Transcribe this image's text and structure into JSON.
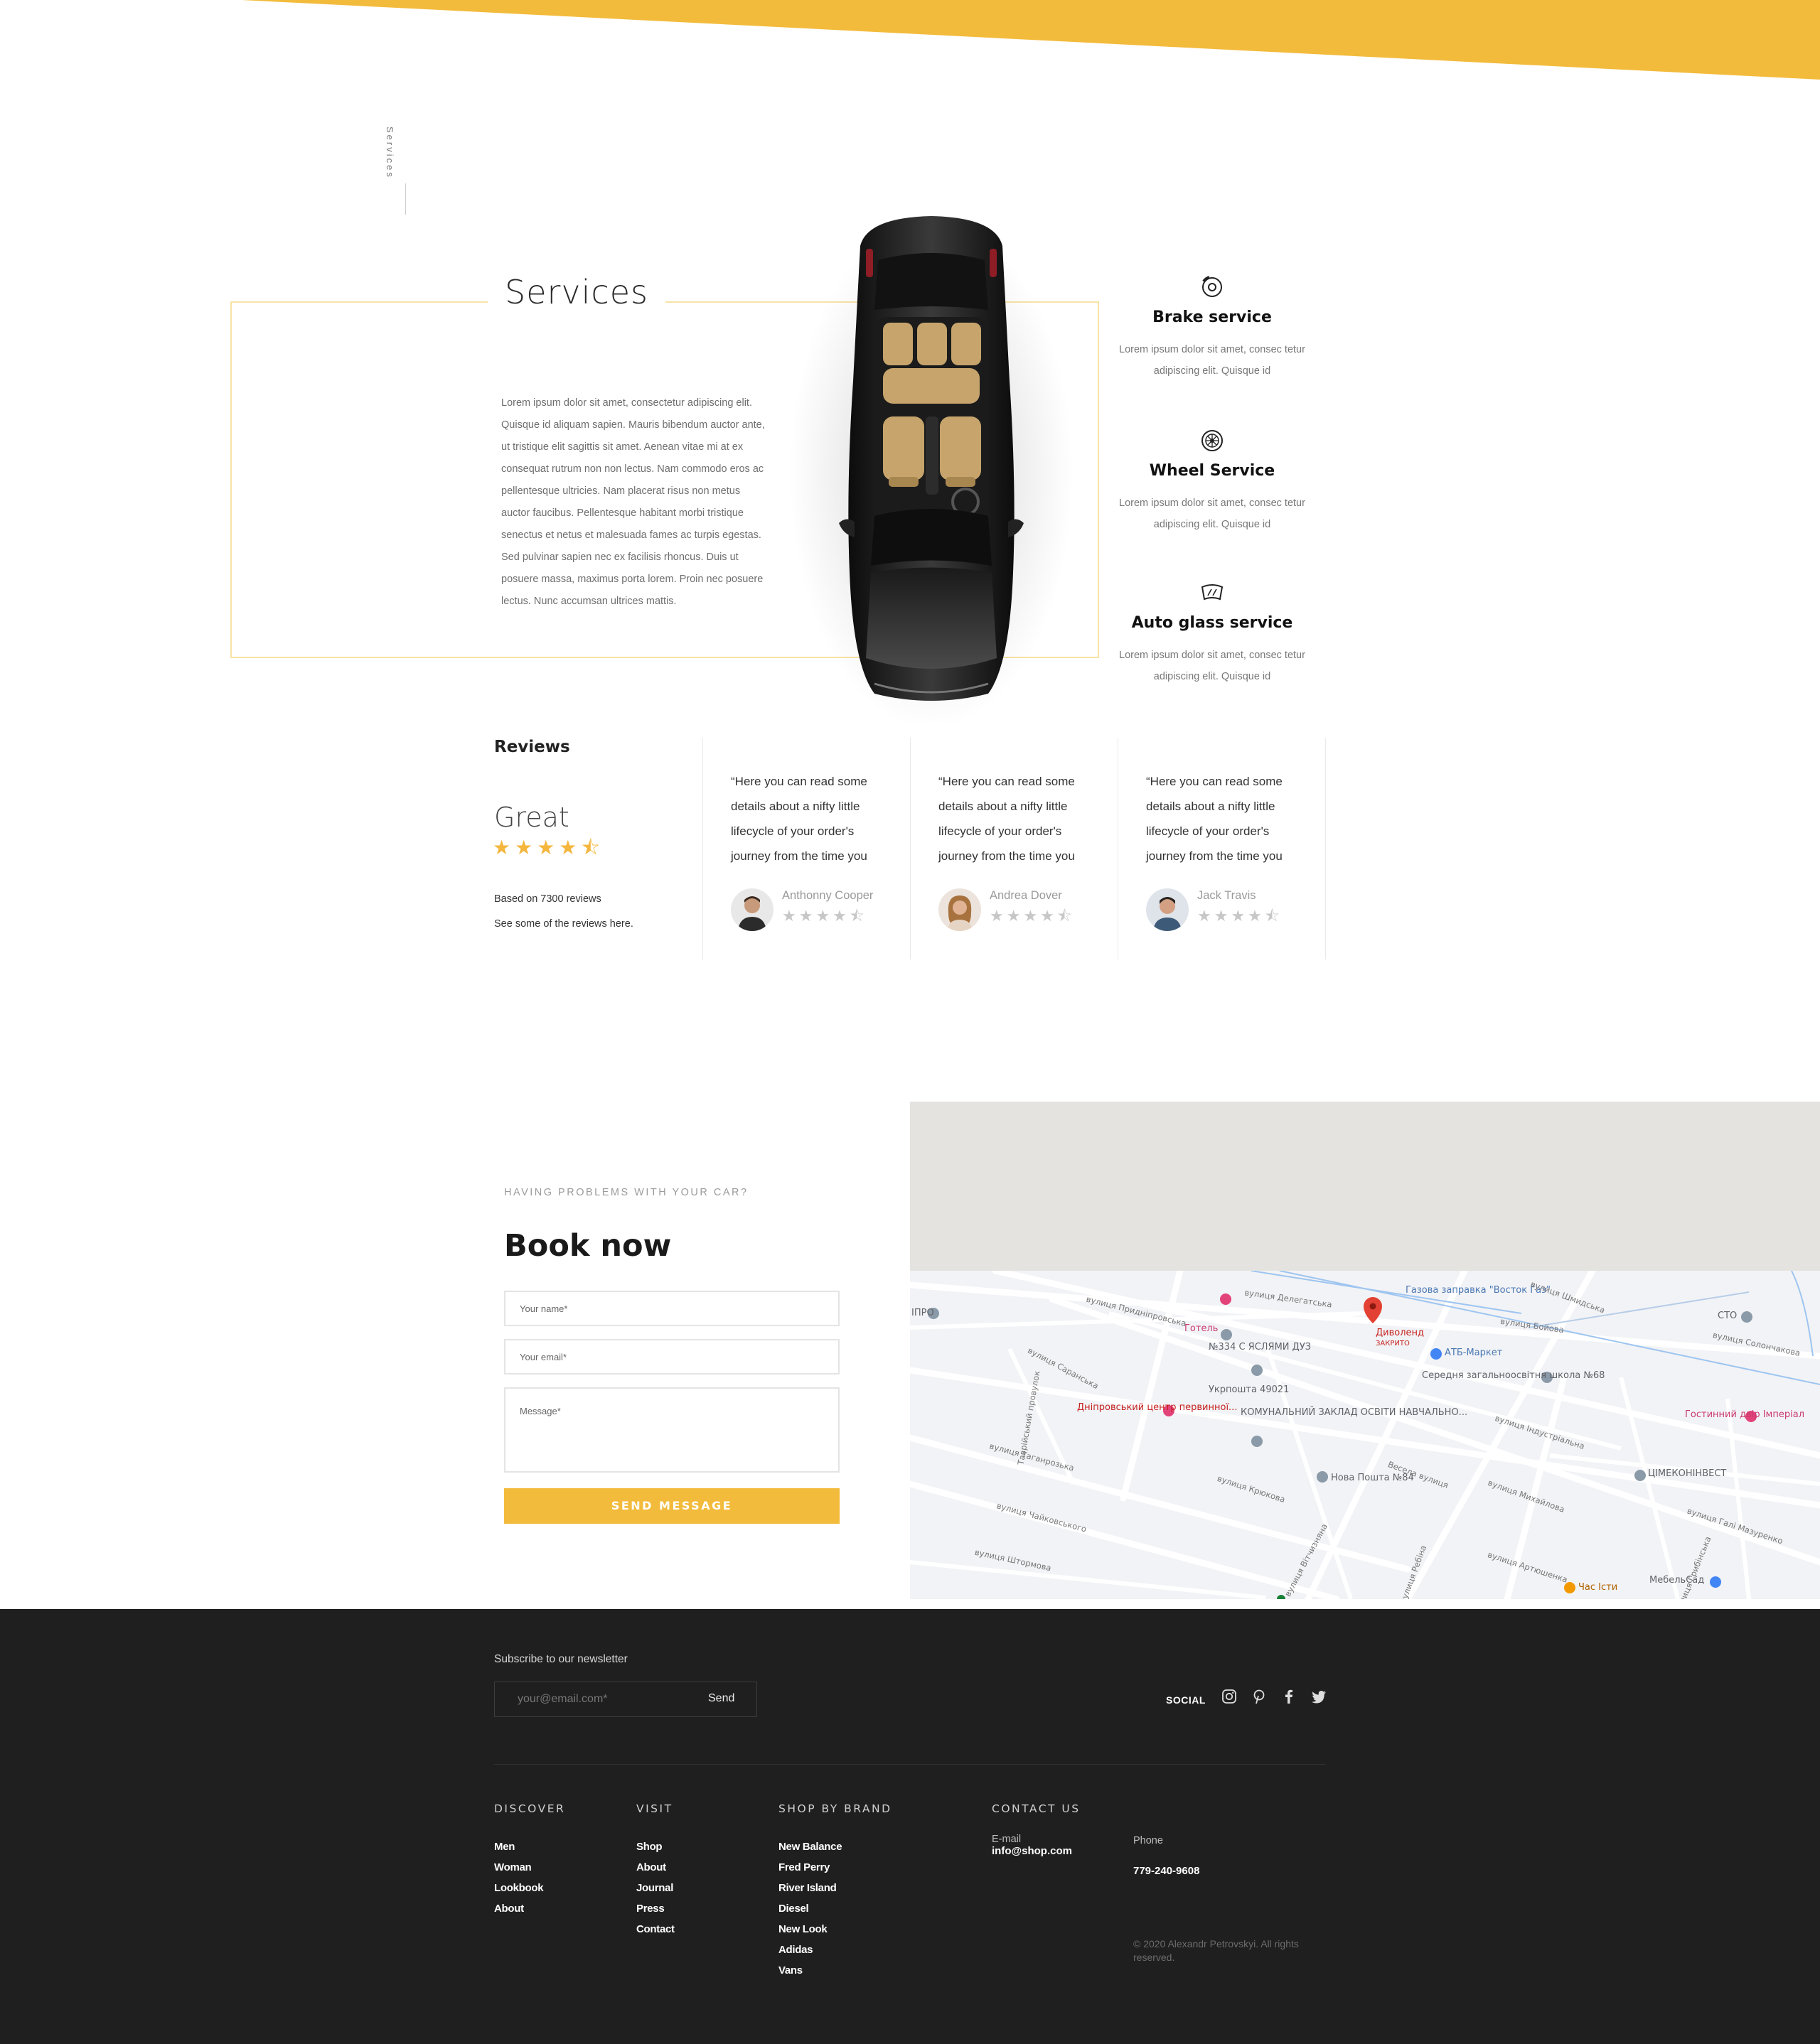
{
  "side_label": "Services",
  "services": {
    "title": "Services",
    "text": "Lorem ipsum dolor sit amet, consectetur adipiscing elit. Quisque id aliquam sapien. Mauris bibendum auctor ante, ut tristique elit sagittis sit amet. Aenean vitae mi at ex consequat rutrum non non lectus. Nam commodo eros ac pellentesque ultricies. Nam placerat risus non metus auctor faucibus. Pellentesque habitant morbi tristique senectus et netus et malesuada fames ac turpis egestas. Sed pulvinar sapien nec ex facilisis rhoncus. Duis ut posuere massa, maximus porta lorem. Proin nec posuere lectus. Nunc accumsan ultrices mattis.",
    "items": [
      {
        "name": "Brake service",
        "desc": "Lorem ipsum dolor sit amet, consec tetur adipiscing elit. Quisque id",
        "icon": "brake-disc-icon"
      },
      {
        "name": "Wheel Service",
        "desc": "Lorem ipsum dolor sit amet, consec tetur adipiscing elit. Quisque id",
        "icon": "wheel-icon"
      },
      {
        "name": "Auto glass service",
        "desc": "Lorem ipsum dolor sit amet, consec tetur adipiscing elit. Quisque id",
        "icon": "windshield-icon"
      }
    ]
  },
  "reviews": {
    "title": "Reviews",
    "rating_word": "Great",
    "rating": 4.5,
    "stars": "★★★★⯪",
    "based_on": "Based on 7300 reviews",
    "see_some": "See some of the reviews here.",
    "items": [
      {
        "quote": "“Here you can read some details about a nifty little lifecycle of your order's journey from the time you",
        "author": "Anthonny Cooper",
        "rating": 4.5,
        "stars": "★★★★⯪"
      },
      {
        "quote": "“Here you can read some details about a nifty little lifecycle of your order's journey from the time you",
        "author": "Andrea Dover",
        "rating": 4.5,
        "stars": "★★★★⯪"
      },
      {
        "quote": "“Here you can read some details about a nifty little lifecycle of your order's journey from the time you",
        "author": "Jack Travis",
        "rating": 4.5,
        "stars": "★★★★⯪"
      }
    ]
  },
  "booking": {
    "eyebrow": "HAVING PROBLEMS WITH YOUR CAR?",
    "title": "Book now",
    "name_placeholder": "Your name*",
    "email_placeholder": "Your email*",
    "message_placeholder": "Message*",
    "send_label": "SEND MESSAGE"
  },
  "map": {
    "places": [
      "Газова заправка \"Восток Газ\"",
      "СТО",
      "Готель",
      "Диволенд",
      "ЗАКРИТО",
      "АТБ-Маркет",
      "№334 С ЯСЛЯМИ ДУЗ",
      "Укрпошта 49021",
      "Середня загальноосвітня школа №68",
      "Дніпровський центр первинної...",
      "КОМУНАЛЬНИЙ ЗАКЛАД ОСВІТИ НАВЧАЛЬНО...",
      "Гостинний двір Імперіал",
      "ЦІМЕКОНІНВЕСТ",
      "Нова Пошта №84",
      "Час Істи",
      "МебельСад",
      "ІПРО"
    ],
    "roads": [
      "вулиця Делегатська",
      "вулиця Придніпровська",
      "вулиця Саранська",
      "вулиця Таганрозька",
      "вулиця Чайковського",
      "вулиця Штормова",
      "вулиця Крюкова",
      "вулиця Михайлова",
      "вулиця Артюшенка",
      "вулиця Бойова",
      "вулиця Солончакова",
      "вулиця Індустріальна",
      "вулиця Галі Мазуренко",
      "вулиця Вітчизняна",
      "Весела вулиця",
      "вулиця Грибінська",
      "Таврійський провулок",
      "вулиця Шмидська",
      "вулиця Ребіна"
    ],
    "colors": {
      "water": "#9ec5f0",
      "roads": "#ffffff",
      "land": "#f2f3f6",
      "pin": "#e34133"
    }
  },
  "footer": {
    "newsletter_label": "Subscribe to our newsletter",
    "newsletter_placeholder": "your@email.com*",
    "newsletter_send": "Send",
    "social_label": "SOCIAL",
    "social_icons": [
      "instagram-icon",
      "pinterest-icon",
      "facebook-icon",
      "twitter-icon"
    ],
    "discover": {
      "title": "DISCOVER",
      "links": [
        "Men",
        "Woman",
        "Lookbook",
        "About"
      ]
    },
    "visit": {
      "title": "VISIT",
      "links": [
        "Shop",
        "About",
        "Journal",
        "Press",
        "Contact"
      ]
    },
    "brands": {
      "title": "SHOP BY BRAND",
      "links": [
        "New Balance",
        "Fred Perry",
        "River Island",
        "Diesel",
        "New Look",
        "Adidas",
        "Vans"
      ]
    },
    "contact": {
      "title": "CONTACT US",
      "email_label": "E-mail",
      "email": "info@shop.com",
      "phone_label": "Phone",
      "phone": "779-240-9608"
    },
    "copyright": "© 2020 Alexandr Petrovskyi. All rights reserved."
  },
  "colors": {
    "accent": "#f3bb3c",
    "footer_bg": "#1f1f1f",
    "frame": "#f8e3a6"
  }
}
